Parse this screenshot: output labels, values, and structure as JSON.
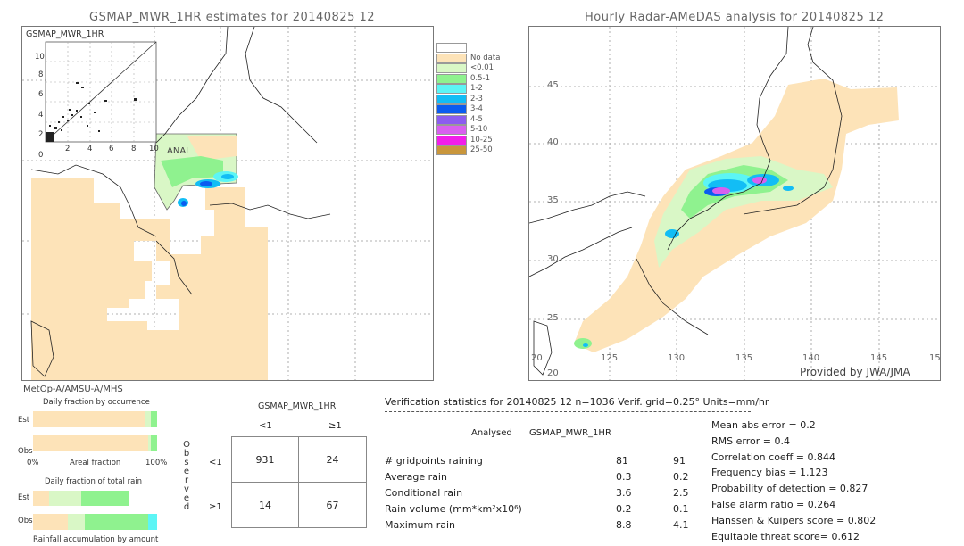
{
  "left_map": {
    "title": "GSMAP_MWR_1HR estimates for 20140825 12",
    "inset_title": "GSMAP_MWR_1HR",
    "inset_y_ticks": [
      "10",
      "8",
      "6",
      "4",
      "2",
      "0"
    ],
    "inset_x_ticks": [
      "2",
      "4",
      "6",
      "8",
      "10"
    ],
    "anal_label": "ANAL",
    "satellite_label": "MetOp-A/AMSU-A/MHS"
  },
  "right_map": {
    "title": "Hourly Radar-AMeDAS analysis for 20140825 12",
    "lat_ticks": [
      "45",
      "40",
      "35",
      "30",
      "25",
      "20"
    ],
    "lon_ticks": [
      "20",
      "125",
      "130",
      "135",
      "140",
      "145",
      "15"
    ],
    "credit": "Provided by JWA/JMA"
  },
  "legend": {
    "items": [
      {
        "label": "",
        "color": "#ffffff"
      },
      {
        "label": "No data",
        "color": "#fde3b8"
      },
      {
        "label": "<0.01",
        "color": "#d9f7c6"
      },
      {
        "label": "0.5-1",
        "color": "#8ff28f"
      },
      {
        "label": "1-2",
        "color": "#5cf5f5"
      },
      {
        "label": "2-3",
        "color": "#12bdf5"
      },
      {
        "label": "3-4",
        "color": "#0a5cf0"
      },
      {
        "label": "4-5",
        "color": "#8c5cf0"
      },
      {
        "label": "5-10",
        "color": "#d860ef"
      },
      {
        "label": "10-25",
        "color": "#f21ee9"
      },
      {
        "label": "25-50",
        "color": "#c9963c"
      }
    ]
  },
  "fraction_charts": {
    "occurrence_title": "Daily fraction by occurrence",
    "est_label": "Est",
    "obs_label": "Obs",
    "axis_left": "0%",
    "axis_mid": "Areal fraction",
    "axis_right": "100%",
    "total_rain_title": "Daily fraction of total rain",
    "accumulation_title": "Rainfall accumulation by amount"
  },
  "contingency": {
    "header": "GSMAP_MWR_1HR",
    "col_labels": [
      "<1",
      "≥1"
    ],
    "row_labels": [
      "<1",
      "≥1"
    ],
    "observed_label": "Observed",
    "cells": [
      [
        "931",
        "24"
      ],
      [
        "14",
        "67"
      ]
    ]
  },
  "verification": {
    "header": "Verification statistics for 20140825 12   n=1036   Verif. grid=0.25°   Units=mm/hr",
    "col_analysed": "Analysed",
    "col_gsmap": "GSMAP_MWR_1HR",
    "rows": [
      {
        "label": "# gridpoints raining",
        "analysed": "81",
        "gsmap": "91"
      },
      {
        "label": "Average rain",
        "analysed": "0.3",
        "gsmap": "0.2"
      },
      {
        "label": "Conditional rain",
        "analysed": "3.6",
        "gsmap": "2.5"
      },
      {
        "label": "Rain volume (mm*km²x10⁶)",
        "analysed": "0.2",
        "gsmap": "0.1"
      },
      {
        "label": "Maximum rain",
        "analysed": "8.8",
        "gsmap": "4.1"
      }
    ],
    "scores": [
      "Mean abs error = 0.2",
      "RMS error = 0.4",
      "Correlation coeff = 0.844",
      "Frequency bias = 1.123",
      "Probability of detection = 0.827",
      "False alarm ratio = 0.264",
      "Hanssen & Kuipers score = 0.802",
      "Equitable threat score= 0.612"
    ]
  }
}
